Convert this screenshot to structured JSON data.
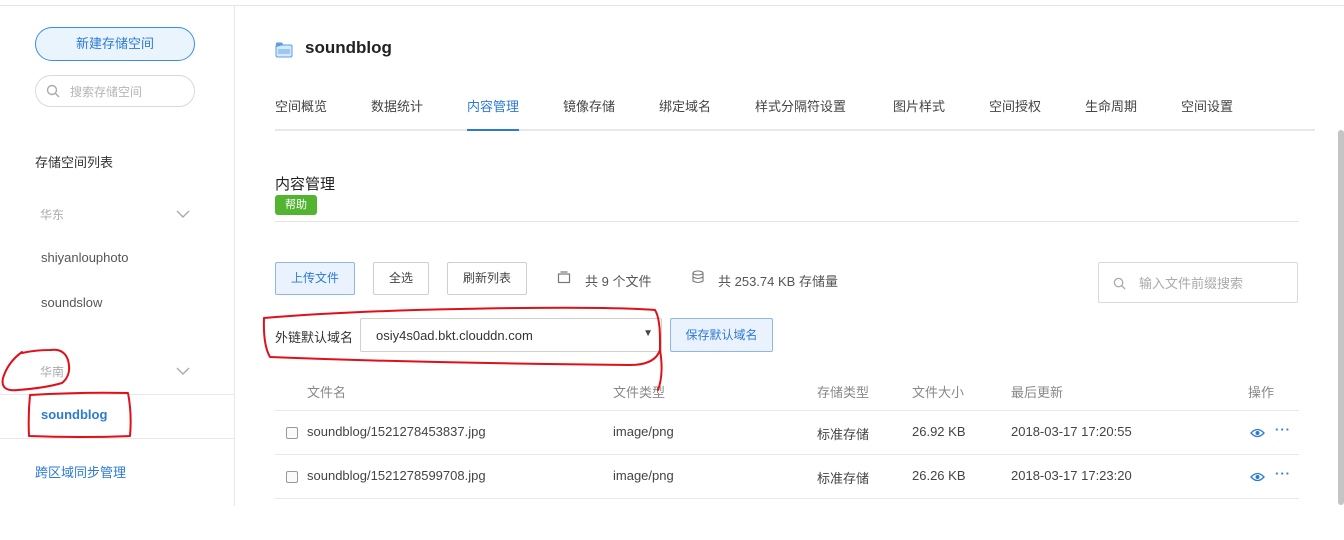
{
  "sidebar": {
    "new_bucket_label": "新建存储空间",
    "search_placeholder": "搜索存储空间",
    "list_title": "存储空间列表",
    "regions": [
      {
        "label": "华东",
        "buckets": [
          "shiyanlouphoto",
          "soundslow"
        ]
      },
      {
        "label": "华南",
        "buckets": [
          "soundblog"
        ]
      }
    ],
    "active_bucket": "soundblog",
    "cross_region_label": "跨区域同步管理"
  },
  "header": {
    "title": "soundblog",
    "tabs": [
      "空间概览",
      "数据统计",
      "内容管理",
      "镜像存储",
      "绑定域名",
      "样式分隔符设置",
      "图片样式",
      "空间授权",
      "生命周期",
      "空间设置"
    ],
    "active_tab": "内容管理"
  },
  "content": {
    "section_title": "内容管理",
    "help_label": "帮助",
    "toolbar": {
      "upload_label": "上传文件",
      "select_all_label": "全选",
      "refresh_label": "刷新列表",
      "file_count_text": "共 9 个文件",
      "storage_text": "共 253.74 KB 存储量",
      "search_placeholder": "输入文件前缀搜索"
    },
    "domain": {
      "label": "外链默认域名",
      "value": "osiy4s0ad.bkt.clouddn.com",
      "save_label": "保存默认域名"
    },
    "table": {
      "columns": [
        "文件名",
        "文件类型",
        "存储类型",
        "文件大小",
        "最后更新",
        "操作"
      ],
      "rows": [
        {
          "name": "soundblog/1521278453837.jpg",
          "type": "image/png",
          "storage": "标准存储",
          "size": "26.92 KB",
          "updated": "2018-03-17 17:20:55"
        },
        {
          "name": "soundblog/1521278599708.jpg",
          "type": "image/png",
          "storage": "标准存储",
          "size": "26.26 KB",
          "updated": "2018-03-17 17:23:20"
        }
      ],
      "more_glyph": "···"
    }
  },
  "colors": {
    "accent": "#2d7ad6",
    "help_badge": "#52b431",
    "annotation": "#e0101a"
  }
}
